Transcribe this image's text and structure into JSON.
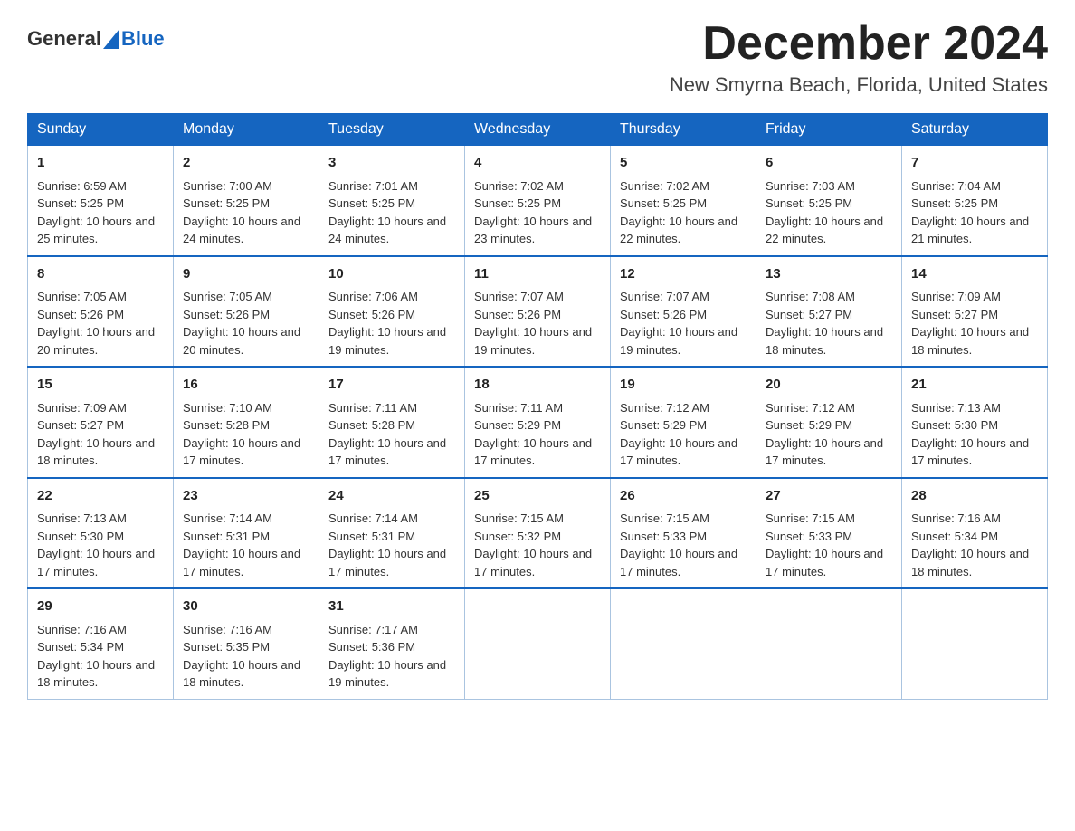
{
  "logo": {
    "general": "General",
    "blue": "Blue"
  },
  "title": "December 2024",
  "location": "New Smyrna Beach, Florida, United States",
  "weekdays": [
    "Sunday",
    "Monday",
    "Tuesday",
    "Wednesday",
    "Thursday",
    "Friday",
    "Saturday"
  ],
  "weeks": [
    [
      {
        "day": "1",
        "sunrise": "6:59 AM",
        "sunset": "5:25 PM",
        "daylight": "10 hours and 25 minutes."
      },
      {
        "day": "2",
        "sunrise": "7:00 AM",
        "sunset": "5:25 PM",
        "daylight": "10 hours and 24 minutes."
      },
      {
        "day": "3",
        "sunrise": "7:01 AM",
        "sunset": "5:25 PM",
        "daylight": "10 hours and 24 minutes."
      },
      {
        "day": "4",
        "sunrise": "7:02 AM",
        "sunset": "5:25 PM",
        "daylight": "10 hours and 23 minutes."
      },
      {
        "day": "5",
        "sunrise": "7:02 AM",
        "sunset": "5:25 PM",
        "daylight": "10 hours and 22 minutes."
      },
      {
        "day": "6",
        "sunrise": "7:03 AM",
        "sunset": "5:25 PM",
        "daylight": "10 hours and 22 minutes."
      },
      {
        "day": "7",
        "sunrise": "7:04 AM",
        "sunset": "5:25 PM",
        "daylight": "10 hours and 21 minutes."
      }
    ],
    [
      {
        "day": "8",
        "sunrise": "7:05 AM",
        "sunset": "5:26 PM",
        "daylight": "10 hours and 20 minutes."
      },
      {
        "day": "9",
        "sunrise": "7:05 AM",
        "sunset": "5:26 PM",
        "daylight": "10 hours and 20 minutes."
      },
      {
        "day": "10",
        "sunrise": "7:06 AM",
        "sunset": "5:26 PM",
        "daylight": "10 hours and 19 minutes."
      },
      {
        "day": "11",
        "sunrise": "7:07 AM",
        "sunset": "5:26 PM",
        "daylight": "10 hours and 19 minutes."
      },
      {
        "day": "12",
        "sunrise": "7:07 AM",
        "sunset": "5:26 PM",
        "daylight": "10 hours and 19 minutes."
      },
      {
        "day": "13",
        "sunrise": "7:08 AM",
        "sunset": "5:27 PM",
        "daylight": "10 hours and 18 minutes."
      },
      {
        "day": "14",
        "sunrise": "7:09 AM",
        "sunset": "5:27 PM",
        "daylight": "10 hours and 18 minutes."
      }
    ],
    [
      {
        "day": "15",
        "sunrise": "7:09 AM",
        "sunset": "5:27 PM",
        "daylight": "10 hours and 18 minutes."
      },
      {
        "day": "16",
        "sunrise": "7:10 AM",
        "sunset": "5:28 PM",
        "daylight": "10 hours and 17 minutes."
      },
      {
        "day": "17",
        "sunrise": "7:11 AM",
        "sunset": "5:28 PM",
        "daylight": "10 hours and 17 minutes."
      },
      {
        "day": "18",
        "sunrise": "7:11 AM",
        "sunset": "5:29 PM",
        "daylight": "10 hours and 17 minutes."
      },
      {
        "day": "19",
        "sunrise": "7:12 AM",
        "sunset": "5:29 PM",
        "daylight": "10 hours and 17 minutes."
      },
      {
        "day": "20",
        "sunrise": "7:12 AM",
        "sunset": "5:29 PM",
        "daylight": "10 hours and 17 minutes."
      },
      {
        "day": "21",
        "sunrise": "7:13 AM",
        "sunset": "5:30 PM",
        "daylight": "10 hours and 17 minutes."
      }
    ],
    [
      {
        "day": "22",
        "sunrise": "7:13 AM",
        "sunset": "5:30 PM",
        "daylight": "10 hours and 17 minutes."
      },
      {
        "day": "23",
        "sunrise": "7:14 AM",
        "sunset": "5:31 PM",
        "daylight": "10 hours and 17 minutes."
      },
      {
        "day": "24",
        "sunrise": "7:14 AM",
        "sunset": "5:31 PM",
        "daylight": "10 hours and 17 minutes."
      },
      {
        "day": "25",
        "sunrise": "7:15 AM",
        "sunset": "5:32 PM",
        "daylight": "10 hours and 17 minutes."
      },
      {
        "day": "26",
        "sunrise": "7:15 AM",
        "sunset": "5:33 PM",
        "daylight": "10 hours and 17 minutes."
      },
      {
        "day": "27",
        "sunrise": "7:15 AM",
        "sunset": "5:33 PM",
        "daylight": "10 hours and 17 minutes."
      },
      {
        "day": "28",
        "sunrise": "7:16 AM",
        "sunset": "5:34 PM",
        "daylight": "10 hours and 18 minutes."
      }
    ],
    [
      {
        "day": "29",
        "sunrise": "7:16 AM",
        "sunset": "5:34 PM",
        "daylight": "10 hours and 18 minutes."
      },
      {
        "day": "30",
        "sunrise": "7:16 AM",
        "sunset": "5:35 PM",
        "daylight": "10 hours and 18 minutes."
      },
      {
        "day": "31",
        "sunrise": "7:17 AM",
        "sunset": "5:36 PM",
        "daylight": "10 hours and 19 minutes."
      },
      null,
      null,
      null,
      null
    ]
  ]
}
